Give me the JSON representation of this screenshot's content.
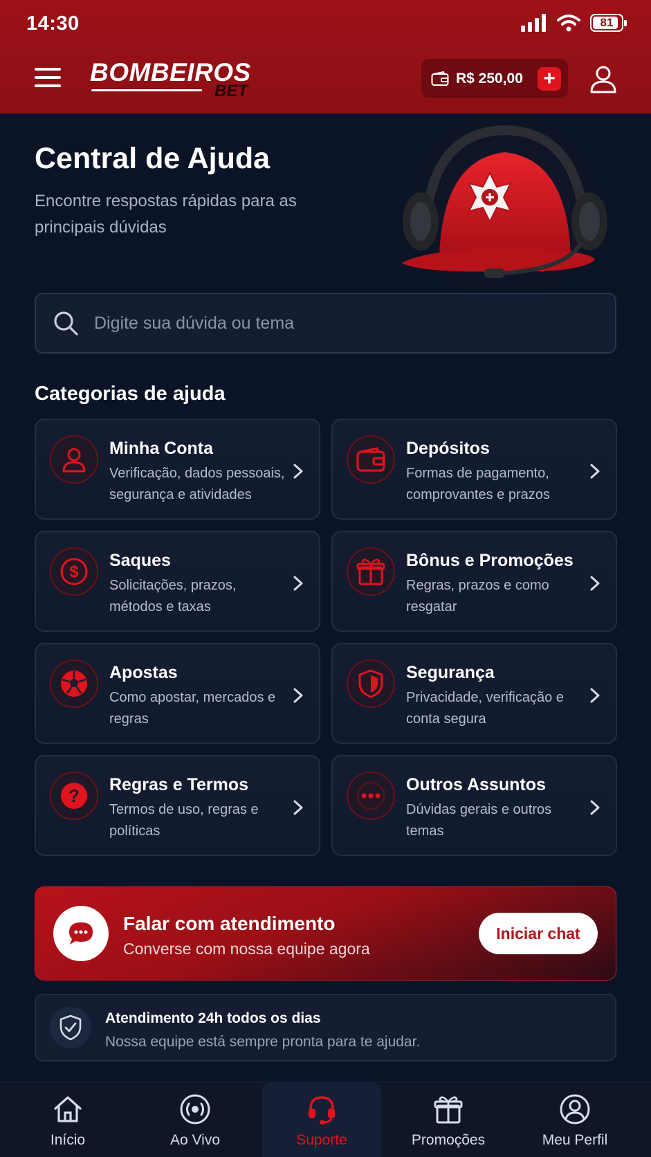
{
  "status_bar": {
    "time": "14:30",
    "battery": "81"
  },
  "header": {
    "logo_main": "BOMBEIROS",
    "logo_sub": "BET",
    "balance": "R$ 250,00",
    "add_label": "+"
  },
  "hero": {
    "title": "Central de Ajuda",
    "subtitle": "Encontre respostas rápidas para as principais dúvidas"
  },
  "search": {
    "placeholder": "Digite sua dúvida ou tema"
  },
  "categories_title": "Categorias de ajuda",
  "categories": [
    {
      "title": "Minha Conta",
      "desc": "Verificação, dados pessoais, segurança e atividades",
      "icon": "user-icon"
    },
    {
      "title": "Depósitos",
      "desc": "Formas de pagamento, comprovantes e prazos",
      "icon": "wallet-icon"
    },
    {
      "title": "Saques",
      "desc": "Solicitações, prazos, métodos e taxas",
      "icon": "dollar-icon"
    },
    {
      "title": "Bônus e Promoções",
      "desc": "Regras, prazos e como resgatar",
      "icon": "gift-icon"
    },
    {
      "title": "Apostas",
      "desc": "Como apostar, mercados e regras",
      "icon": "soccer-ball-icon"
    },
    {
      "title": "Segurança",
      "desc": "Privacidade, verificação e conta segura",
      "icon": "shield-icon"
    },
    {
      "title": "Regras e Termos",
      "desc": "Termos de uso, regras e políticas",
      "icon": "question-icon"
    },
    {
      "title": "Outros Assuntos",
      "desc": "Dúvidas gerais e outros temas",
      "icon": "more-icon"
    }
  ],
  "chat": {
    "title": "Falar com atendimento",
    "subtitle": "Converse com nossa equipe agora",
    "button": "Iniciar chat"
  },
  "support_info": {
    "title": "Atendimento 24h todos os dias",
    "subtitle": "Nossa equipe está sempre pronta para te ajudar."
  },
  "nav": [
    {
      "label": "Início",
      "icon": "home-icon",
      "active": false
    },
    {
      "label": "Ao Vivo",
      "icon": "live-icon",
      "active": false
    },
    {
      "label": "Suporte",
      "icon": "headset-icon",
      "active": true
    },
    {
      "label": "Promoções",
      "icon": "gift-icon",
      "active": false
    },
    {
      "label": "Meu Perfil",
      "icon": "profile-icon",
      "active": false
    }
  ],
  "colors": {
    "primary_red": "#b5121a",
    "background": "#0b1426",
    "accent": "#e0141e"
  }
}
